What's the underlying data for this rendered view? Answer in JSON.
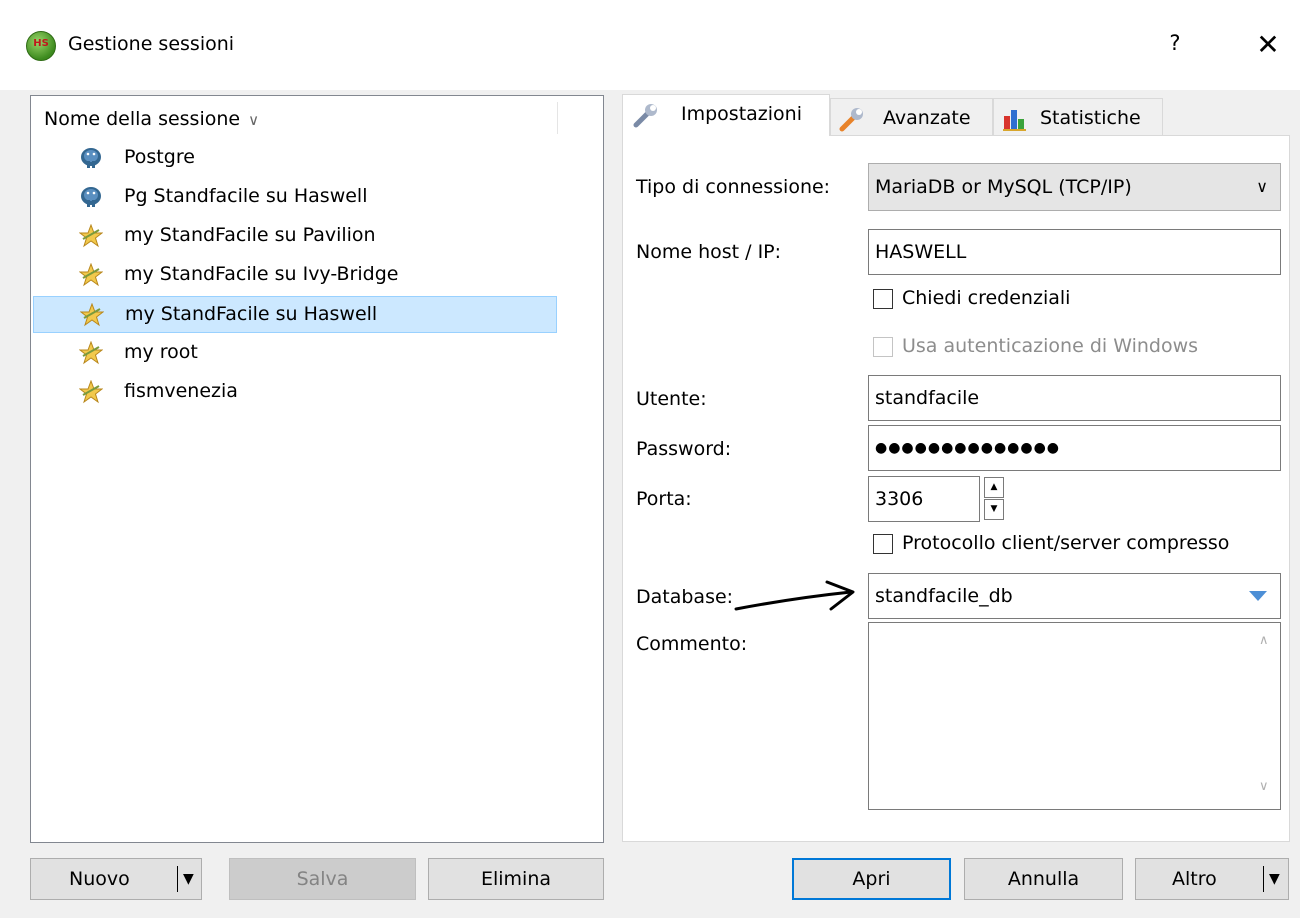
{
  "window": {
    "title": "Gestione sessioni",
    "app_icon_text": "HS",
    "help_label": "?",
    "close_label": "✕"
  },
  "session_list": {
    "column_header": "Nome della sessione",
    "items": [
      {
        "label": "Postgre",
        "icon": "postgresql-elephant-icon"
      },
      {
        "label": "Pg Standfacile su Haswell",
        "icon": "postgresql-elephant-icon"
      },
      {
        "label": "my StandFacile su Pavilion",
        "icon": "mysql-star-icon"
      },
      {
        "label": "my StandFacile su Ivy-Bridge",
        "icon": "mysql-star-icon"
      },
      {
        "label": "my StandFacile su Haswell",
        "icon": "mysql-star-icon",
        "selected": true
      },
      {
        "label": "my root",
        "icon": "mysql-star-icon"
      },
      {
        "label": "fismvenezia",
        "icon": "mysql-star-icon"
      }
    ]
  },
  "tabs": [
    {
      "label": "Impostazioni",
      "icon": "wrench-icon",
      "active": true
    },
    {
      "label": "Avanzate",
      "icon": "wrench-orange-icon",
      "active": false
    },
    {
      "label": "Statistiche",
      "icon": "bar-chart-icon",
      "active": false
    }
  ],
  "settings": {
    "connection_type_label": "Tipo di connessione:",
    "connection_type_value": "MariaDB or MySQL (TCP/IP)",
    "host_label": "Nome host / IP:",
    "host_value": "HASWELL",
    "ask_credentials_label": "Chiedi credenziali",
    "windows_auth_label": "Usa autenticazione di Windows",
    "user_label": "Utente:",
    "user_value": "standfacile",
    "password_label": "Password:",
    "password_value": "●●●●●●●●●●●●●●",
    "port_label": "Porta:",
    "port_value": "3306",
    "compressed_label": "Protocollo client/server compresso",
    "database_label": "Database:",
    "database_value": "standfacile_db",
    "comment_label": "Commento:",
    "comment_value": ""
  },
  "buttons": {
    "new": "Nuovo",
    "save": "Salva",
    "delete": "Elimina",
    "open": "Apri",
    "cancel": "Annulla",
    "more": "Altro"
  },
  "colors": {
    "selection_bg": "#cce8ff",
    "selection_border": "#99d1ff",
    "default_button_border": "#0078d7",
    "dropdown_arrow_blue": "#4d8fd6"
  }
}
